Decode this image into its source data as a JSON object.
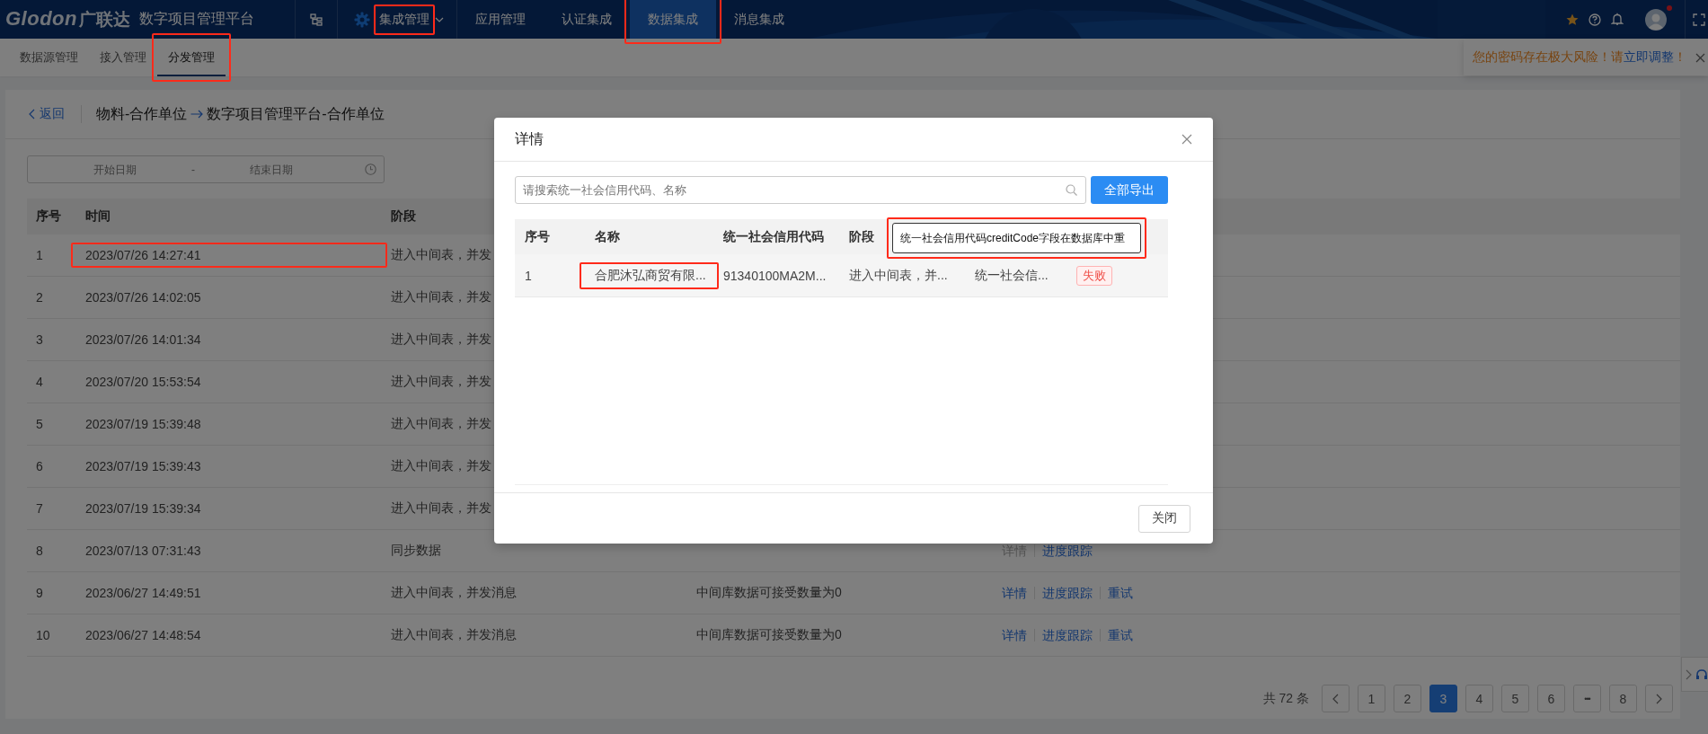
{
  "topbar": {
    "logo_latin": "Glodon",
    "logo_cjk": "广联达",
    "app_name": "数字项目管理平台",
    "nav": [
      {
        "label": "集成管理",
        "kind": "dropdown",
        "selected": false,
        "marked": true
      },
      {
        "label": "应用管理",
        "kind": "plain",
        "selected": false,
        "marked": false
      },
      {
        "label": "认证集成",
        "kind": "plain",
        "selected": false,
        "marked": false
      },
      {
        "label": "数据集成",
        "kind": "plain",
        "selected": true,
        "marked": true
      },
      {
        "label": "消息集成",
        "kind": "plain",
        "selected": false,
        "marked": false
      }
    ],
    "user": {
      "notification_dot": true
    }
  },
  "subnav": [
    {
      "label": "数据源管理",
      "selected": false,
      "marked": false
    },
    {
      "label": "接入管理",
      "selected": false,
      "marked": false
    },
    {
      "label": "分发管理",
      "selected": true,
      "marked": true
    }
  ],
  "notice": {
    "text_before": "您的密码存在极大风险！请",
    "link": "立即调整",
    "text_after": "！"
  },
  "page": {
    "back": "返回",
    "title_source": "物料-合作单位",
    "title_target": "数字项目管理平台-合作单位",
    "date_range": {
      "start_placeholder": "开始日期",
      "separator": "-",
      "end_placeholder": "结束日期"
    }
  },
  "table": {
    "columns": [
      "序号",
      "时间",
      "阶段"
    ],
    "rows": [
      {
        "index": "1",
        "time": "2023/07/26 14:27:41",
        "stage": "进入中间表，并发",
        "marked": true
      },
      {
        "index": "2",
        "time": "2023/07/26 14:02:05",
        "stage": "进入中间表，并发",
        "marked": false
      },
      {
        "index": "3",
        "time": "2023/07/26 14:01:34",
        "stage": "进入中间表，并发",
        "marked": false
      },
      {
        "index": "4",
        "time": "2023/07/20 15:53:54",
        "stage": "进入中间表，并发",
        "marked": false
      },
      {
        "index": "5",
        "time": "2023/07/19 15:39:48",
        "stage": "进入中间表，并发",
        "marked": false
      },
      {
        "index": "6",
        "time": "2023/07/19 15:39:43",
        "stage": "进入中间表，并发",
        "marked": false
      },
      {
        "index": "7",
        "time": "2023/07/19 15:39:34",
        "stage": "进入中间表，并发",
        "marked": false
      },
      {
        "index": "8",
        "time": "2023/07/13 07:31:43",
        "stage": "同步数据",
        "marked": false,
        "actions": [
          {
            "label": "详情",
            "disabled": true
          },
          {
            "label": "进度跟踪",
            "disabled": false
          }
        ]
      },
      {
        "index": "9",
        "time": "2023/06/27 14:49:51",
        "stage": "进入中间表，并发消息",
        "column_4": "中间库数据可接受数量为0",
        "marked": false,
        "actions": [
          {
            "label": "详情",
            "disabled": false
          },
          {
            "label": "进度跟踪",
            "disabled": false
          },
          {
            "label": "重试",
            "disabled": false
          }
        ]
      },
      {
        "index": "10",
        "time": "2023/06/27 14:48:54",
        "stage": "进入中间表，并发消息",
        "column_4": "中间库数据可接受数量为0",
        "marked": false,
        "actions": [
          {
            "label": "详情",
            "disabled": false
          },
          {
            "label": "进度跟踪",
            "disabled": false
          },
          {
            "label": "重试",
            "disabled": false
          }
        ]
      }
    ]
  },
  "pagination": {
    "total": "共 72 条",
    "pages": [
      {
        "label": "1",
        "kind": "page",
        "selected": false
      },
      {
        "label": "2",
        "kind": "page",
        "selected": false
      },
      {
        "label": "3",
        "kind": "page",
        "selected": true
      },
      {
        "label": "4",
        "kind": "page",
        "selected": false
      },
      {
        "label": "5",
        "kind": "page",
        "selected": false
      },
      {
        "label": "6",
        "kind": "page",
        "selected": false
      },
      {
        "label": "•••",
        "kind": "ellipsis",
        "selected": false
      },
      {
        "label": "8",
        "kind": "page",
        "selected": false
      }
    ]
  },
  "modal": {
    "title": "详情",
    "search_placeholder": "请搜索统一社会信用代码、名称",
    "export_button": "全部导出",
    "columns": [
      "序号",
      "名称",
      "统一社会信用代码",
      "阶段"
    ],
    "rows": [
      {
        "cells": [
          {
            "text": "1",
            "marked": false
          },
          {
            "text": "合肥沐弘商贸有限...",
            "marked": true
          },
          {
            "text": "91340100MA2M...",
            "marked": false
          },
          {
            "text": "进入中间表，并...",
            "marked": false
          },
          {
            "text": "统一社会信...",
            "marked": false
          }
        ],
        "status": {
          "text": "失败",
          "kind": "fail"
        }
      }
    ],
    "tooltip": {
      "text": "统一社会信用代码creditCode字段在数据库中重",
      "marked": true
    },
    "close_button": "关闭"
  }
}
